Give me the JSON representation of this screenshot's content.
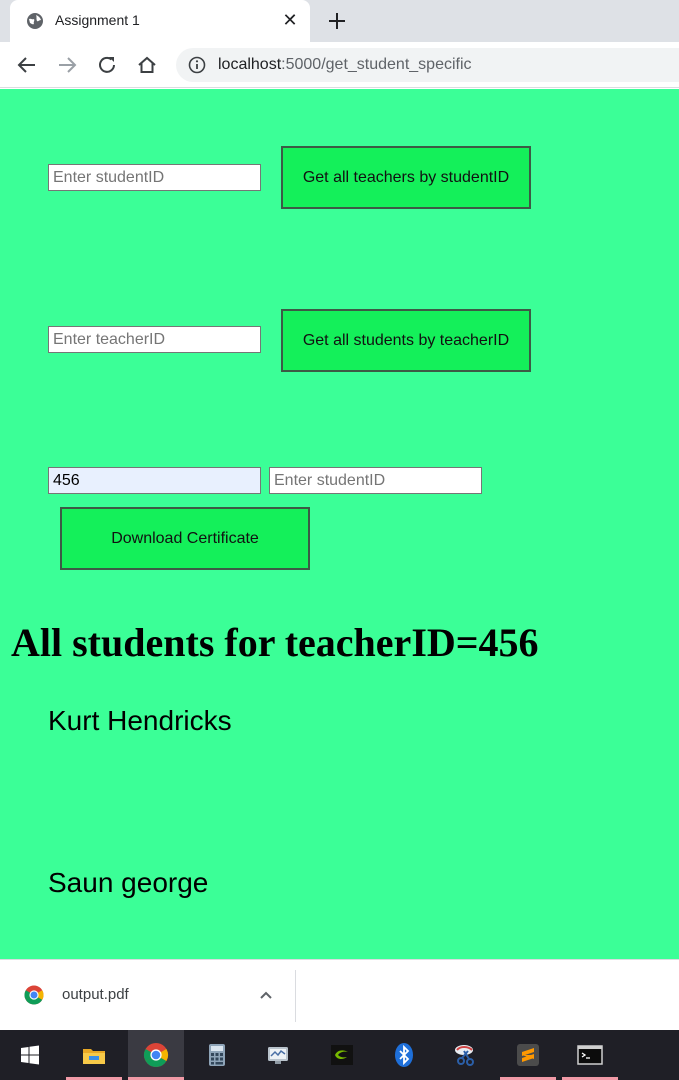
{
  "browser": {
    "tab_title": "Assignment 1",
    "url_host": "localhost",
    "url_path": ":5000/get_student_specific"
  },
  "form1": {
    "input_placeholder": "Enter studentID",
    "button_label": "Get all teachers by studentID"
  },
  "form2": {
    "input_placeholder": "Enter teacherID",
    "button_label": "Get all students by teacherID"
  },
  "form3": {
    "teacher_input_value": "456",
    "student_input_placeholder": "Enter studentID",
    "button_label": "Download Certificate"
  },
  "results": {
    "heading": "All students for teacherID=456",
    "students": [
      "Kurt Hendricks",
      "Saun george"
    ]
  },
  "downloads": {
    "file_name": "output.pdf"
  },
  "taskbar": {
    "items": [
      "start",
      "file-explorer",
      "chrome",
      "calculator",
      "system-monitor",
      "nvidia",
      "bluetooth",
      "snipping-tool",
      "sublime-text",
      "terminal"
    ]
  },
  "colors": {
    "page_background": "#3bff97",
    "button_background": "#14f05a",
    "taskbar": "#1f1f26"
  }
}
